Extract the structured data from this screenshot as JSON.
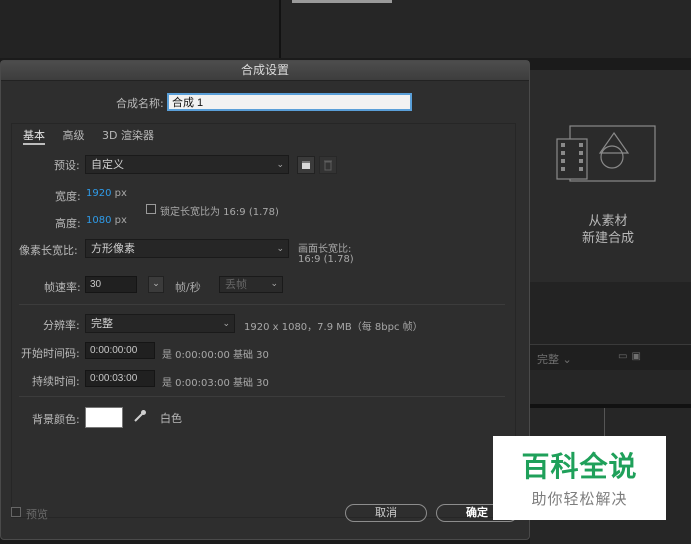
{
  "background": {
    "new_comp_line1": "从素材",
    "new_comp_line2": "新建合成",
    "quality_label": "完整",
    "icons": [
      "film-icon",
      "monitor-icon"
    ]
  },
  "dialog": {
    "title": "合成设置",
    "comp_name_label": "合成名称:",
    "comp_name_value": "合成 1",
    "tabs": [
      "基本",
      "高级",
      "3D 渲染器"
    ],
    "preset": {
      "label": "预设:",
      "value": "自定义"
    },
    "width": {
      "label": "宽度:",
      "value": "1920",
      "unit": "px"
    },
    "height": {
      "label": "高度:",
      "value": "1080",
      "unit": "px"
    },
    "lock_aspect": {
      "label": "锁定长宽比为 16:9 (1.78)",
      "checked": false
    },
    "pixel_aspect": {
      "label": "像素长宽比:",
      "value": "方形像素"
    },
    "frame_aspect": {
      "label": "画面长宽比:",
      "value": "16:9 (1.78)"
    },
    "frame_rate": {
      "label": "帧速率:",
      "value": "30",
      "unit": "帧/秒",
      "drop_frame": "丢帧"
    },
    "resolution": {
      "label": "分辨率:",
      "value": "完整",
      "info": "1920 x 1080，7.9 MB（每 8bpc 帧）"
    },
    "start_timecode": {
      "label": "开始时间码:",
      "value": "0:00:00:00",
      "info": "是 0:00:00:00 基础 30"
    },
    "duration": {
      "label": "持续时间:",
      "value": "0:00:03:00",
      "info": "是 0:00:03:00 基础 30"
    },
    "bg_color": {
      "label": "背景颜色:",
      "value": "#ffffff",
      "name": "白色"
    },
    "preview_label": "预览",
    "cancel_label": "取消",
    "ok_label": "确定"
  },
  "watermark": {
    "title": "百科全说",
    "subtitle": "助你轻松解决"
  },
  "colors": {
    "accent_blue": "#2f9be8",
    "dialog_bg": "#2e2e2e",
    "watermark_green": "#1fa05a"
  }
}
